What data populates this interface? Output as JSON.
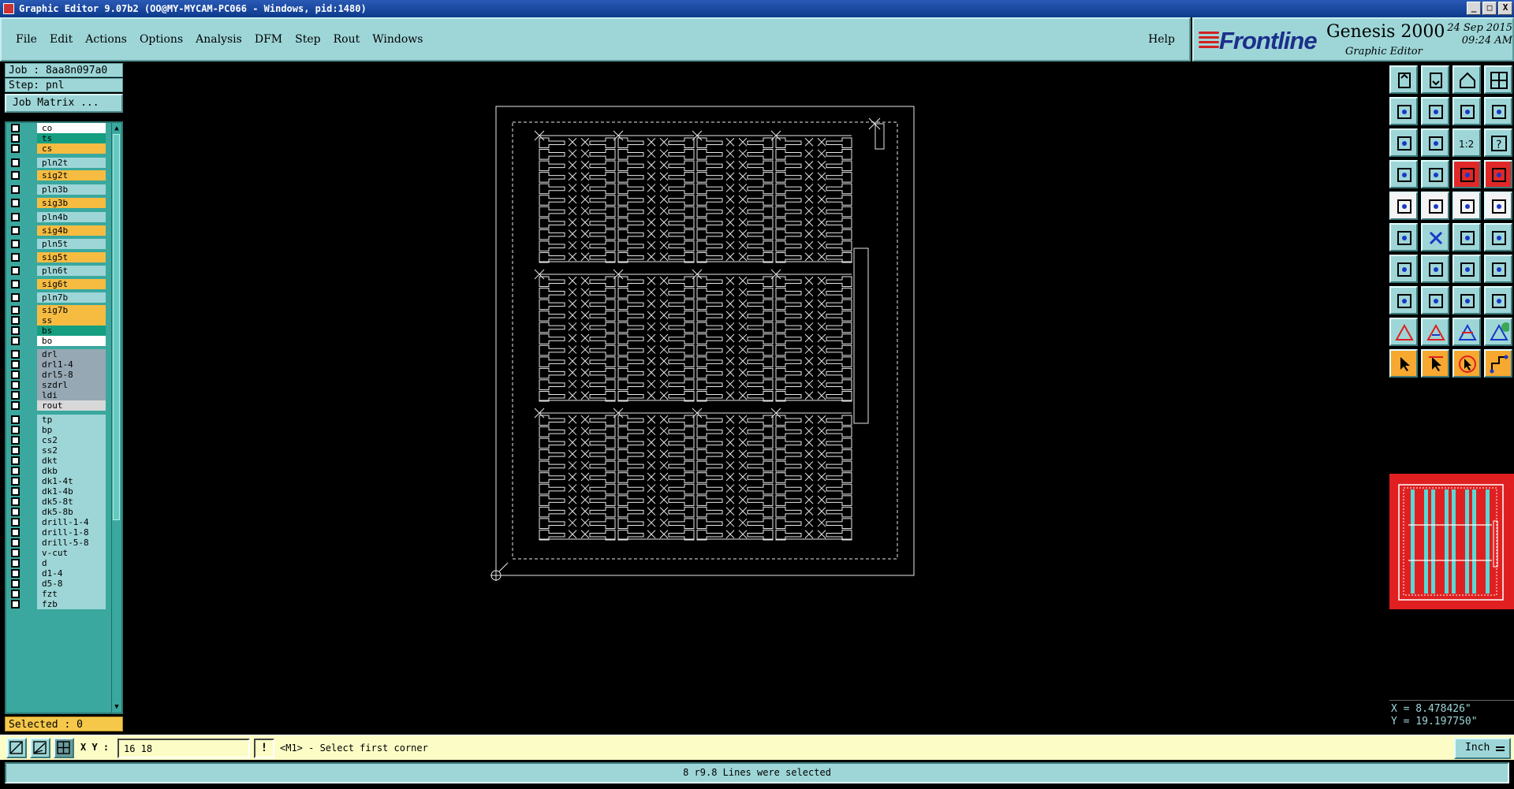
{
  "window": {
    "title": "Graphic Editor 9.07b2 (OO@MY-MYCAM-PC066 - Windows, pid:1480)",
    "controls": [
      "_",
      "□",
      "X"
    ]
  },
  "menubar": {
    "items": [
      "File",
      "Edit",
      "Actions",
      "Options",
      "Analysis",
      "DFM",
      "Step",
      "Rout",
      "Windows"
    ],
    "help": "Help"
  },
  "brand": {
    "logo": "Frontline",
    "product": "Genesis 2000",
    "subtitle": "Graphic Editor",
    "date": "24 Sep 2015",
    "time": "09:24 AM"
  },
  "left_panel": {
    "job": "Job : 8aa8n097a0",
    "step": "Step: pnl",
    "job_matrix_button": "Job Matrix ...",
    "selected": "Selected : 0",
    "layers": [
      {
        "name": "co",
        "color": "#ffffff"
      },
      {
        "name": "ts",
        "color": "#169e80"
      },
      {
        "name": "cs",
        "color": "#f6bc42"
      },
      {
        "name": "pln2t",
        "color": "#9ed6d8"
      },
      {
        "name": "sig2t",
        "color": "#f6bc42"
      },
      {
        "name": "pln3b",
        "color": "#9ed6d8"
      },
      {
        "name": "sig3b",
        "color": "#f6bc42"
      },
      {
        "name": "pln4b",
        "color": "#9ed6d8"
      },
      {
        "name": "sig4b",
        "color": "#f6bc42"
      },
      {
        "name": "pln5t",
        "color": "#9ed6d8"
      },
      {
        "name": "sig5t",
        "color": "#f6bc42"
      },
      {
        "name": "pln6t",
        "color": "#9ed6d8"
      },
      {
        "name": "sig6t",
        "color": "#f6bc42"
      },
      {
        "name": "pln7b",
        "color": "#9ed6d8"
      },
      {
        "name": "sig7b",
        "color": "#f6bc42"
      },
      {
        "name": "ss",
        "color": "#f6bc42"
      },
      {
        "name": "bs",
        "color": "#169e80"
      },
      {
        "name": "bo",
        "color": "#ffffff"
      },
      {
        "name": "drl",
        "color": "#96a8b4"
      },
      {
        "name": "drl1-4",
        "color": "#96a8b4"
      },
      {
        "name": "drl5-8",
        "color": "#96a8b4"
      },
      {
        "name": "szdrl",
        "color": "#96a8b4"
      },
      {
        "name": "ldi",
        "color": "#96a8b4"
      },
      {
        "name": "rout",
        "color": "#d8d8d8"
      },
      {
        "name": "tp",
        "color": "#9ed6d8"
      },
      {
        "name": "bp",
        "color": "#9ed6d8"
      },
      {
        "name": "cs2",
        "color": "#9ed6d8"
      },
      {
        "name": "ss2",
        "color": "#9ed6d8"
      },
      {
        "name": "dkt",
        "color": "#9ed6d8"
      },
      {
        "name": "dkb",
        "color": "#9ed6d8"
      },
      {
        "name": "dk1-4t",
        "color": "#9ed6d8"
      },
      {
        "name": "dk1-4b",
        "color": "#9ed6d8"
      },
      {
        "name": "dk5-8t",
        "color": "#9ed6d8"
      },
      {
        "name": "dk5-8b",
        "color": "#9ed6d8"
      },
      {
        "name": "drill-1-4",
        "color": "#9ed6d8"
      },
      {
        "name": "drill-1-8",
        "color": "#9ed6d8"
      },
      {
        "name": "drill-5-8",
        "color": "#9ed6d8"
      },
      {
        "name": "v-cut",
        "color": "#9ed6d8"
      },
      {
        "name": "d",
        "color": "#9ed6d8"
      },
      {
        "name": "d1-4",
        "color": "#9ed6d8"
      },
      {
        "name": "d5-8",
        "color": "#9ed6d8"
      },
      {
        "name": "fzt",
        "color": "#9ed6d8"
      },
      {
        "name": "fzb",
        "color": "#9ed6d8"
      }
    ]
  },
  "toolbox": {
    "icons": [
      "zoom-home-icon",
      "zoom-out-icon",
      "home-icon",
      "split-view-icon",
      "pan-left-icon",
      "pan-right-icon",
      "zoom-window-icon",
      "redraw-icon",
      "fit-all-icon",
      "center-icon",
      "scale-one-to-two-icon",
      "help-icon",
      "snap-icon",
      "grid-icon",
      "layers-compare-icon",
      "layers-compare-2-icon",
      "measure-icon",
      "draw-outline-icon",
      "ruler-icon",
      "pad-icon",
      "connect-icon",
      "cross-icon",
      "line-node-icon",
      "arc-node-icon",
      "angle-icon",
      "slash-icon",
      "arc-icon",
      "split-lines-icon",
      "selection-icon",
      "line-icon",
      "measure-range-icon",
      "pad-group-icon",
      "triangle-icon",
      "triangle-a-icon",
      "triangle-lock-icon",
      "triangle-green-icon",
      "select-arrow-icon",
      "select-arrow-2-icon",
      "select-arrow-3-icon",
      "route-icon"
    ],
    "scale_label": "1:2",
    "help_label": "?"
  },
  "coordinates": {
    "x": "X = 8.478426\"",
    "y": "Y = 19.197750\""
  },
  "command_bar": {
    "xy_label": "X Y :",
    "xy_value": "16 18",
    "prompt_icon": "!",
    "prompt": "<M1> - Select first corner",
    "units": "Inch"
  },
  "status": {
    "message": "8 r9.8 Lines were selected"
  },
  "panel": {
    "rows": 3,
    "columns": 4,
    "pad_rows_per_board": 11
  }
}
